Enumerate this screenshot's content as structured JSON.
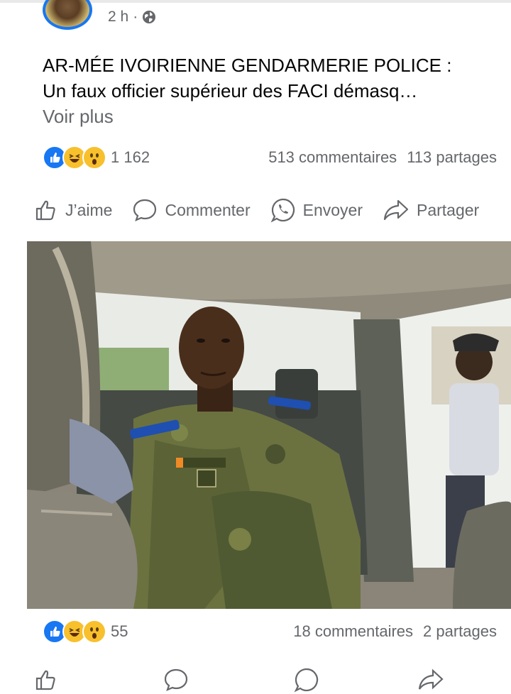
{
  "post": {
    "time": "2 h",
    "separator": "·",
    "text_line1": "AR-MÉE IVOIRIENNE GENDARMERIE POLICE :",
    "text_line2": "Un faux officier supérieur des FACI démasq…",
    "see_more": "Voir plus",
    "reactions_count": "1 162",
    "comments": "513 commentaires",
    "shares": "113 partages"
  },
  "actions": {
    "like": "J’aime",
    "comment": "Commenter",
    "send": "Envoyer",
    "share": "Partager"
  },
  "next_post": {
    "reactions_count": "55",
    "comments": "18 commentaires",
    "shares": "2 partages"
  },
  "colors": {
    "accent": "#1877f2",
    "secondary_text": "#65676b",
    "reaction_yellow": "#f7c02c"
  },
  "icons": [
    "globe-icon",
    "like-reaction-icon",
    "haha-reaction-icon",
    "wow-reaction-icon",
    "thumbs-up-icon",
    "comment-icon",
    "whatsapp-icon",
    "share-icon"
  ]
}
